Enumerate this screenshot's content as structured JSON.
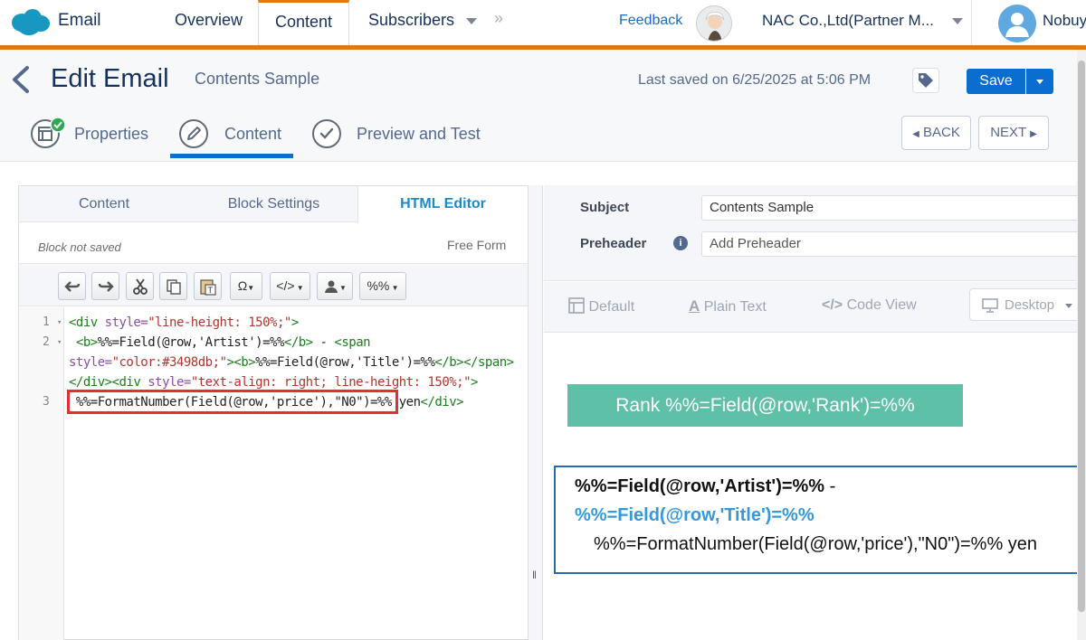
{
  "topnav": {
    "app_name": "Email",
    "tabs": [
      {
        "label": "Overview"
      },
      {
        "label": "Content"
      },
      {
        "label": "Subscribers"
      }
    ],
    "feedback": "Feedback",
    "company": "NAC Co.,Ltd(Partner M...",
    "username": "Nobuy",
    "accent_color": "#e07a10"
  },
  "header": {
    "title": "Edit Email",
    "email_name": "Contents Sample",
    "last_saved": "Last saved on 6/25/2025 at 5:06 PM",
    "save_label": "Save"
  },
  "steps": [
    {
      "label": "Properties",
      "complete": true
    },
    {
      "label": "Content",
      "active": true
    },
    {
      "label": "Preview and Test"
    }
  ],
  "nav_buttons": {
    "back": "BACK",
    "next": "NEXT"
  },
  "editor": {
    "tabs": [
      "Content",
      "Block Settings",
      "HTML Editor"
    ],
    "active_tab": "HTML Editor",
    "block_status": "Block not saved",
    "block_type": "Free Form",
    "toolbar": {
      "omega": "Ω",
      "code": "</>",
      "personalize": "",
      "ampscript": "%%"
    },
    "line_numbers": [
      "1",
      "2",
      "3"
    ],
    "code": {
      "l1": {
        "open": "<div ",
        "attr": "style=",
        "val": "\"line-height: 150%;\"",
        "close": ">"
      },
      "l2a": {
        "b_open": "<b>",
        "text": "%%=Field(@row,'Artist')=%%",
        "b_close": "</b>",
        "mid": " - ",
        "span_open": "<span"
      },
      "l2b": {
        "attr": "style=",
        "val": "\"color:#3498db;\"",
        "close": ">",
        "b_open": "<b>",
        "text": "%%=Field(@row,'Title')=%%",
        "b_close": "</b></span>"
      },
      "l2c": {
        "div_close": "</div>",
        "div_open": "<div ",
        "attr": "style=",
        "val": "\"text-align: right; line-height: 150%;\"",
        "close": ">"
      },
      "l3": {
        "text": " %%=FormatNumber(Field(@row,'price'),\"N0\")=%%",
        "tail": " yen",
        "div_close": "</div>"
      }
    }
  },
  "preview": {
    "subject_label": "Subject",
    "subject_value": "Contents Sample",
    "preheader_label": "Preheader",
    "preheader_placeholder": "Add Preheader",
    "views": [
      "Default",
      "Plain Text",
      "Code View"
    ],
    "device": "Desktop",
    "rank_banner": "Rank %%=Field(@row,'Rank')=%%",
    "artist_line": "%%=Field(@row,'Artist')=%%",
    "artist_sep": " -",
    "title_line": "%%=Field(@row,'Title')=%%",
    "price_line": "%%=FormatNumber(Field(@row,'price'),\"N0\")=%% yen",
    "banner_color": "#5ec1a7",
    "title_color": "#3498db"
  }
}
